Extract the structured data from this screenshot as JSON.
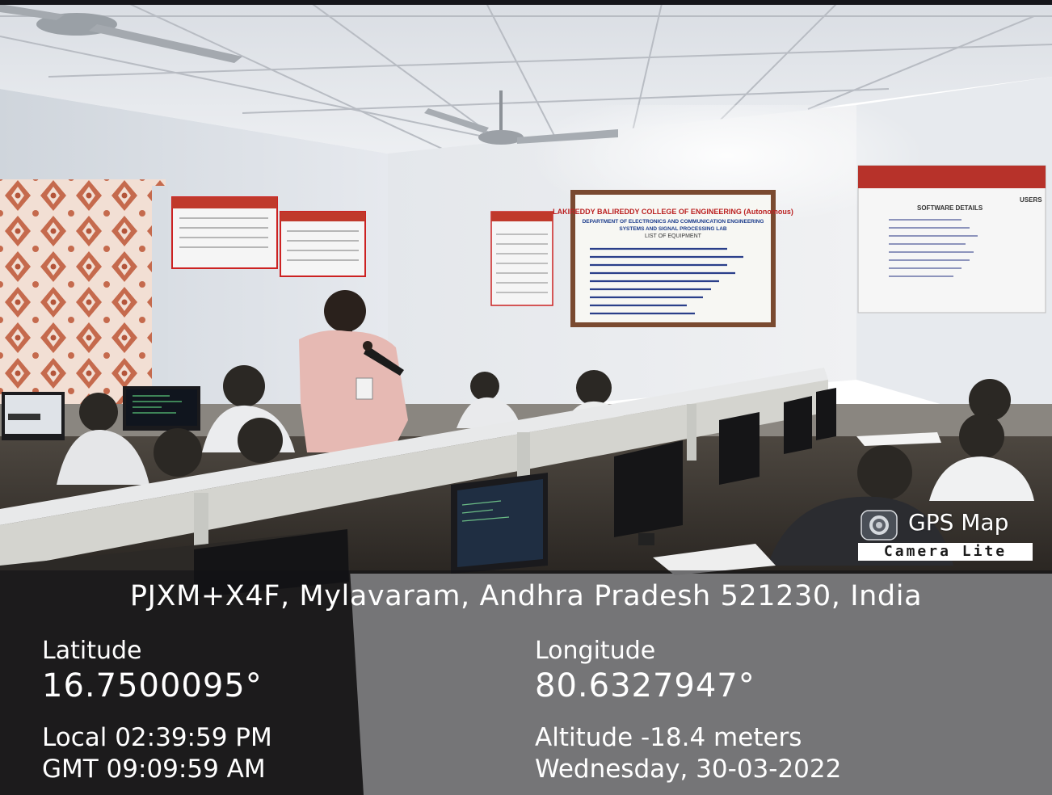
{
  "overlay": {
    "address": "PJXM+X4F, Mylavaram, Andhra Pradesh 521230, India",
    "latitude_label": "Latitude",
    "latitude_value": "16.7500095°",
    "longitude_label": "Longitude",
    "longitude_value": "80.6327947°",
    "local_time": "Local 02:39:59 PM",
    "gmt_time": "GMT 09:09:59 AM",
    "altitude": "Altitude -18.4 meters",
    "date": "Wednesday, 30-03-2022"
  },
  "watermark": {
    "title": "GPS Map",
    "subtitle": "Camera Lite",
    "icon": "camera-lens-icon"
  },
  "scene": {
    "board_title": "LAKIREDDY BALIREDDY COLLEGE OF ENGINEERING (Autonomous)",
    "board_subtitle": "DEPARTMENT OF ELECTRONICS AND COMMUNICATION ENGINEERING",
    "board_lab": "SYSTEMS AND SIGNAL PROCESSING LAB",
    "board_list": "LIST OF EQUIPMENT",
    "right_board_heading": "SOFTWARE DETAILS",
    "right_board_users": "USERS"
  },
  "colors": {
    "overlay_bg": "#121214",
    "overlay_text": "#ffffff",
    "wall": "#e9ecef",
    "curtain": "#c96b4c",
    "board_frame": "#7a4a30"
  }
}
